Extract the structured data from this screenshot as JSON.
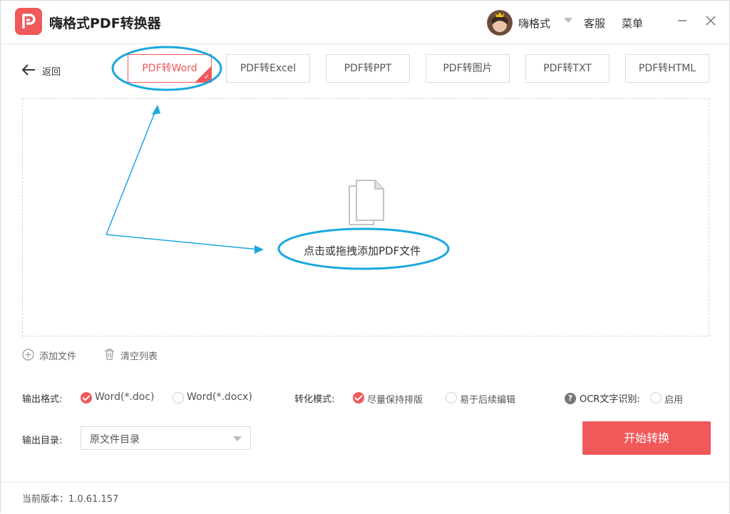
{
  "app": {
    "title": "嗨格式PDF转换器"
  },
  "header": {
    "username": "嗨格式",
    "support_label": "客服",
    "menu_label": "菜单"
  },
  "nav": {
    "back_label": "返回"
  },
  "tabs": [
    {
      "label": "PDF转Word",
      "active": true
    },
    {
      "label": "PDF转Excel",
      "active": false
    },
    {
      "label": "PDF转PPT",
      "active": false
    },
    {
      "label": "PDF转图片",
      "active": false
    },
    {
      "label": "PDF转TXT",
      "active": false
    },
    {
      "label": "PDF转HTML",
      "active": false
    }
  ],
  "dropzone": {
    "label": "点击或拖拽添加PDF文件"
  },
  "file_actions": {
    "add_label": "添加文件",
    "clear_label": "清空列表"
  },
  "output_format": {
    "label": "输出格式:",
    "options": [
      {
        "label": "Word(*.doc)",
        "selected": true
      },
      {
        "label": "Word(*.docx)",
        "selected": false
      }
    ]
  },
  "convert_mode": {
    "label": "转化模式:",
    "options": [
      {
        "label": "尽量保持排版",
        "selected": true
      },
      {
        "label": "易于后续编辑",
        "selected": false
      }
    ]
  },
  "ocr": {
    "label": "OCR文字识别:",
    "enable_label": "启用",
    "enabled": false
  },
  "output_dir": {
    "label": "输出目录:",
    "value": "原文件目录"
  },
  "start_button": {
    "label": "开始转换"
  },
  "footer": {
    "version": "当前版本：1.0.61.157"
  },
  "colors": {
    "accent": "#f0585a",
    "annotation": "#1aa7e0"
  }
}
